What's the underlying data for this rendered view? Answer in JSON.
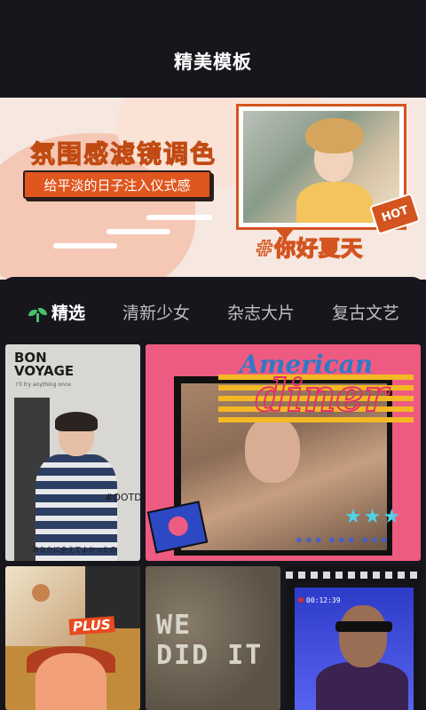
{
  "header": {
    "title": "精美模板"
  },
  "banner": {
    "headline": "氛围感滤镜调色",
    "subline": "给平淡的日子注入仪式感",
    "badge": "HOT",
    "tagline": "#你好夏天"
  },
  "tabs": [
    {
      "label": "精选",
      "active": true,
      "icon": "sprout-icon"
    },
    {
      "label": "清新少女",
      "active": false
    },
    {
      "label": "杂志大片",
      "active": false
    },
    {
      "label": "复古文艺",
      "active": false
    }
  ],
  "cards": [
    {
      "title_lines": [
        "BON",
        "VOYAGE"
      ],
      "subtitle": "I'll try anything once",
      "tag": "#OOTD",
      "caption": "あなたに会えてよかったの"
    },
    {
      "title": "American",
      "script": "diner",
      "stars": "★★★",
      "stars_small": "★★★ ★★★ ★★★"
    },
    {
      "badge": "PLUS"
    },
    {
      "text": "WE\nDID IT"
    },
    {
      "timecode": "00:12:39"
    }
  ],
  "colors": {
    "background": "#16161c",
    "accent_orange": "#e0561f",
    "accent_green": "#47c16a",
    "card_pink": "#ee5b80"
  }
}
